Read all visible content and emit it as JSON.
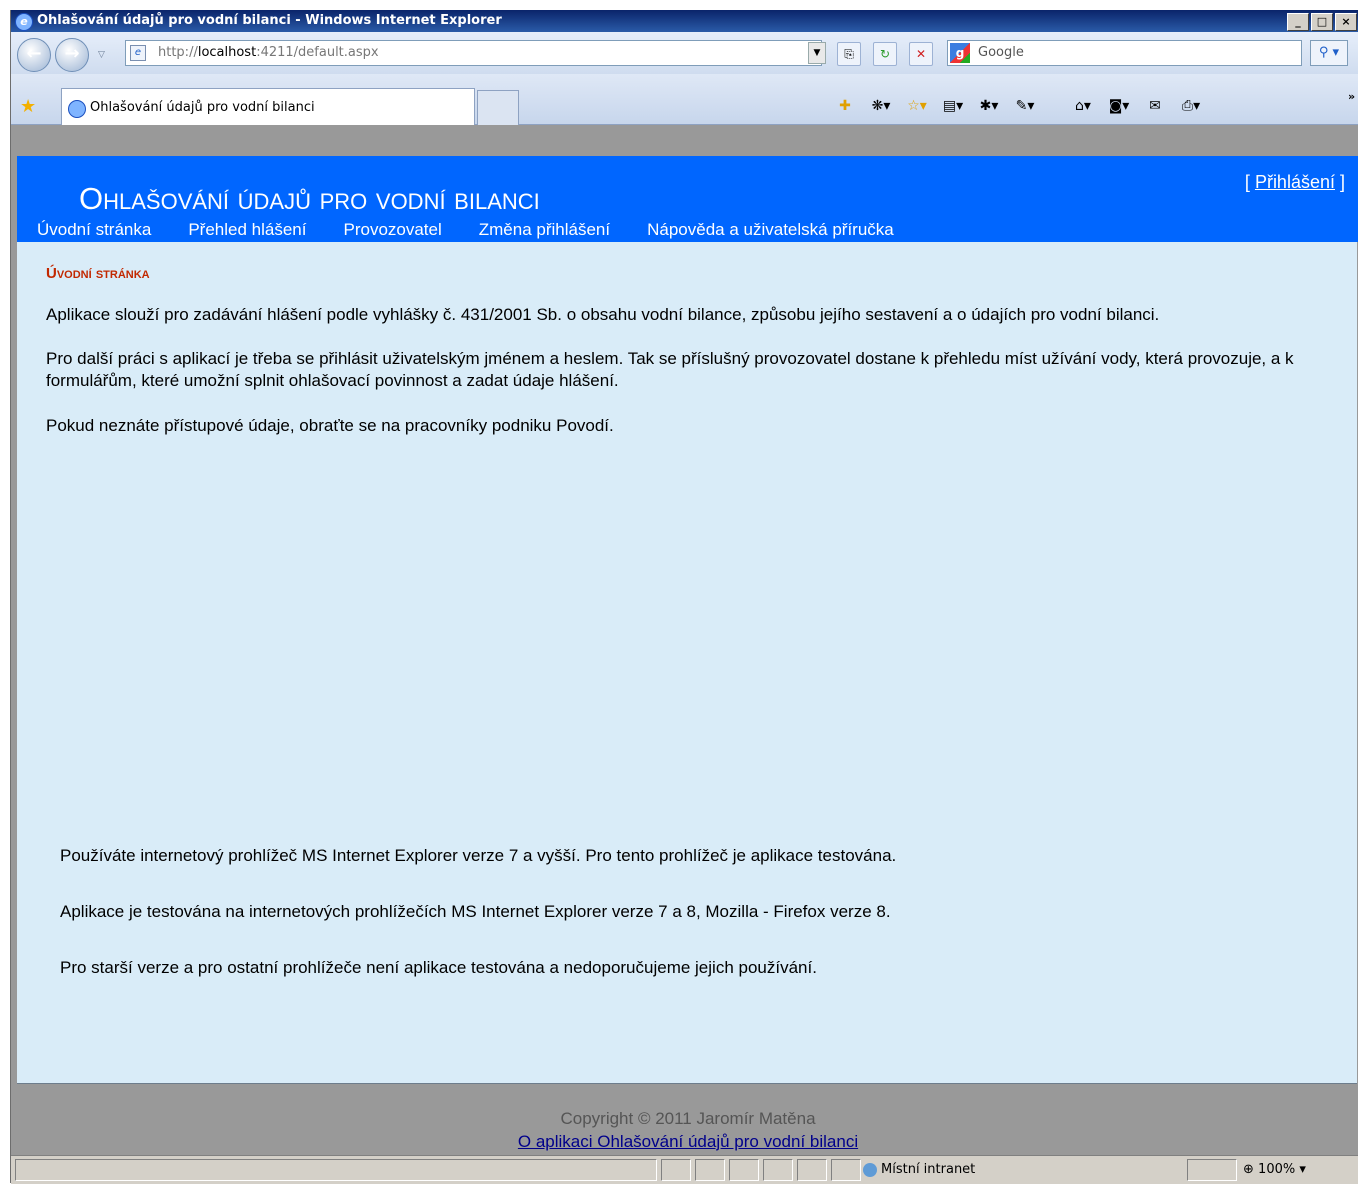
{
  "window": {
    "title": "Ohlašování údajů pro vodní bilanci - Windows Internet Explorer",
    "buttons": [
      "_",
      "□",
      "×"
    ]
  },
  "addressbar": {
    "url_prefix": "http://",
    "url_host": "localhost",
    "url_rest": ":4211/default.aspx",
    "search_placeholder": "Google"
  },
  "tab": {
    "label": "Ohlašování údajů pro vodní bilanci"
  },
  "page": {
    "site_title": "Ohlašování údajů pro vodní bilanci",
    "login_prefix": "[ ",
    "login_link": "Přihlášení",
    "login_suffix": " ]",
    "menu": [
      "Úvodní stránka",
      "Přehled hlášení",
      "Provozovatel",
      "Změna přihlášení",
      "Nápověda a uživatelská příručka"
    ],
    "section_title": "Úvodní stránka",
    "paragraphs": [
      "Aplikace slouží pro zadávání hlášení podle vyhlášky č. 431/2001 Sb. o obsahu vodní bilance, způsobu jejího sestavení a o údajích pro vodní bilanci.",
      "Pro další práci s aplikací je třeba se přihlásit uživatelským jménem a heslem. Tak se příslušný provozovatel dostane k přehledu míst užívání vody, která provozuje, a k formulářům, které umožní splnit ohlašovací povinnost a zadat údaje hlášení.",
      "Pokud neznáte přístupové údaje, obraťte se na pracovníky podniku Povodí."
    ],
    "browser_notes": [
      "Používáte internetový prohlížeč MS Internet Explorer verze 7 a vyšší. Pro tento prohlížeč je aplikace testována.",
      "Aplikace je testována na internetových prohlížečích MS Internet Explorer verze 7 a 8, Mozilla - Firefox verze 8.",
      "Pro starší verze a pro ostatní prohlížeče není aplikace testována a nedoporučujeme jejich používání."
    ],
    "footer_copyright": "Copyright © 2011 Jaromír Matěna",
    "footer_link": "O aplikaci Ohlašování údajů pro vodní bilanci"
  },
  "statusbar": {
    "zone": "Místní intranet",
    "zoom": "100%"
  },
  "colors": {
    "header_blue": "#0066ff",
    "content_bg": "#d9ecf8",
    "section_title": "#c22800",
    "footer_bg": "#999999"
  }
}
